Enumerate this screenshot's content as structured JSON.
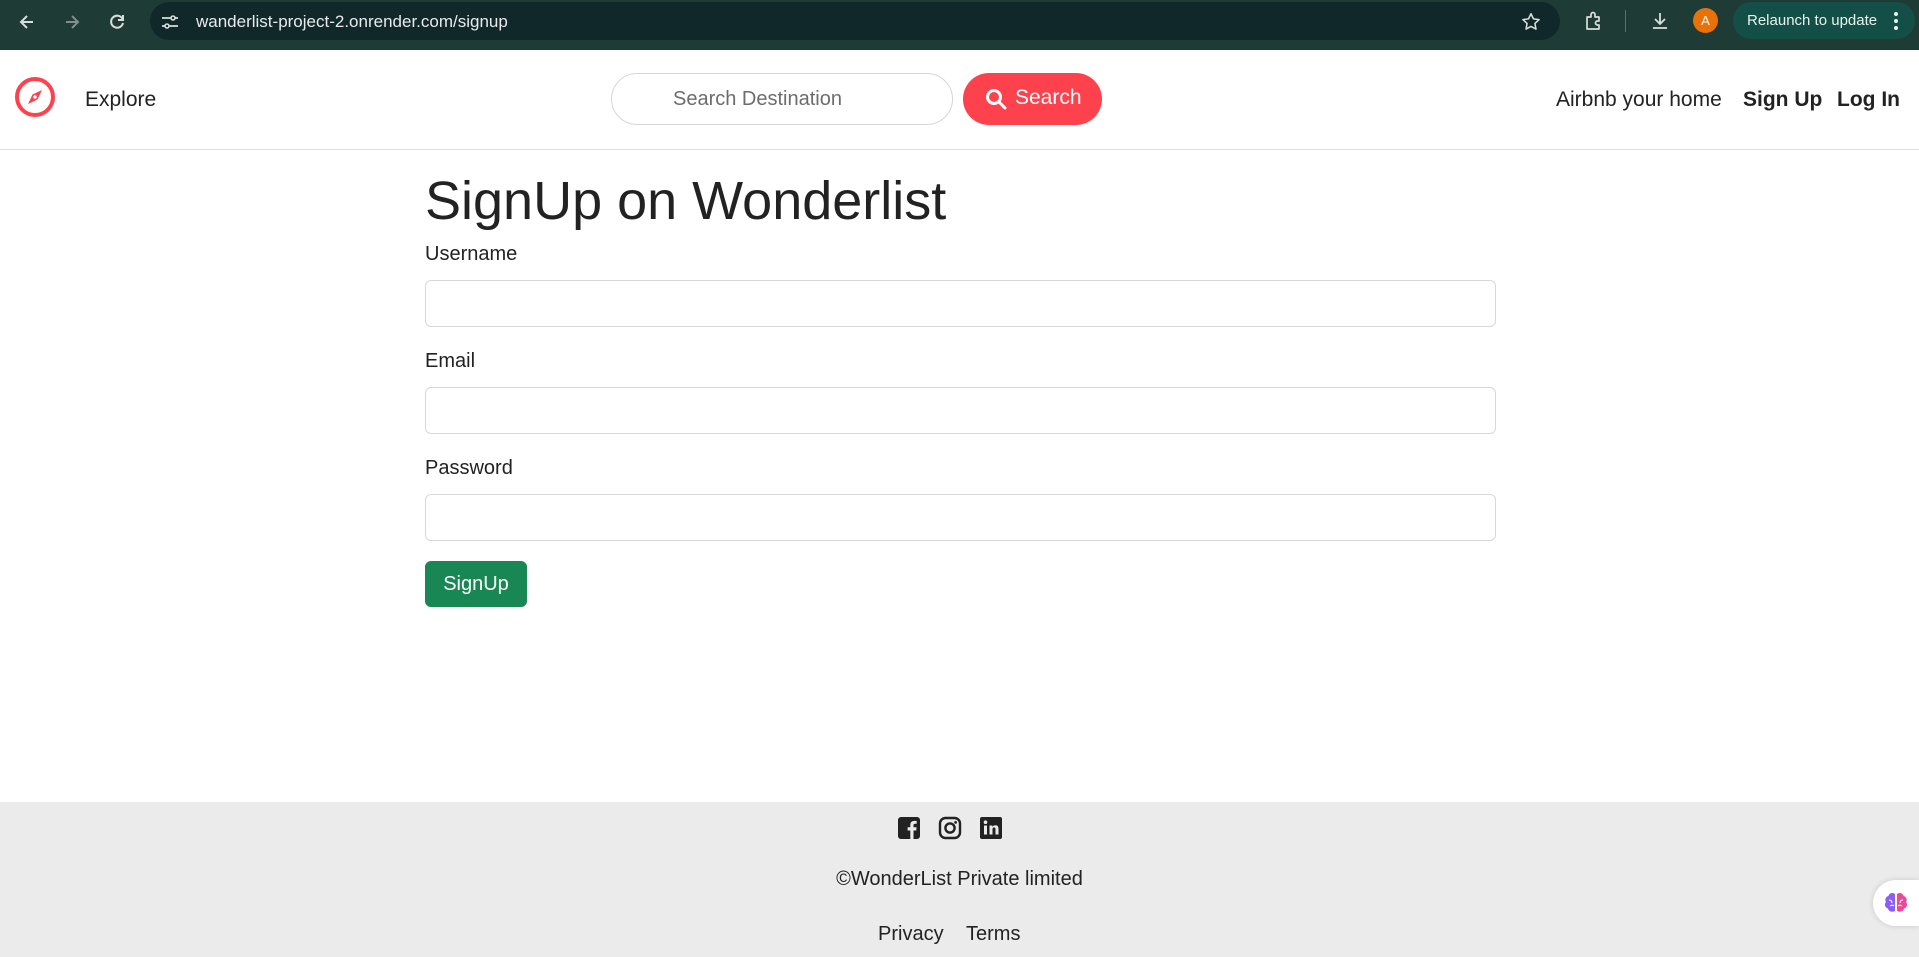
{
  "browser": {
    "url": "wanderlist-project-2.onrender.com/signup",
    "avatar_letter": "A",
    "relaunch_label": "Relaunch to update"
  },
  "navbar": {
    "explore_label": "Explore",
    "search_placeholder": "Search Destination",
    "search_button_label": "Search",
    "host_link": "Airbnb your home",
    "signup_link": "Sign Up",
    "login_link": "Log In",
    "accent_color": "#fe424d"
  },
  "form": {
    "title": "SignUp on Wonderlist",
    "username_label": "Username",
    "username_value": "",
    "email_label": "Email",
    "email_value": "",
    "password_label": "Password",
    "password_value": "",
    "submit_label": "SignUp",
    "submit_color": "#198754"
  },
  "footer": {
    "social_icons": [
      "facebook-icon",
      "instagram-icon",
      "linkedin-icon"
    ],
    "copyright": "©WonderList Private limited",
    "links": [
      "Privacy",
      "Terms"
    ]
  }
}
